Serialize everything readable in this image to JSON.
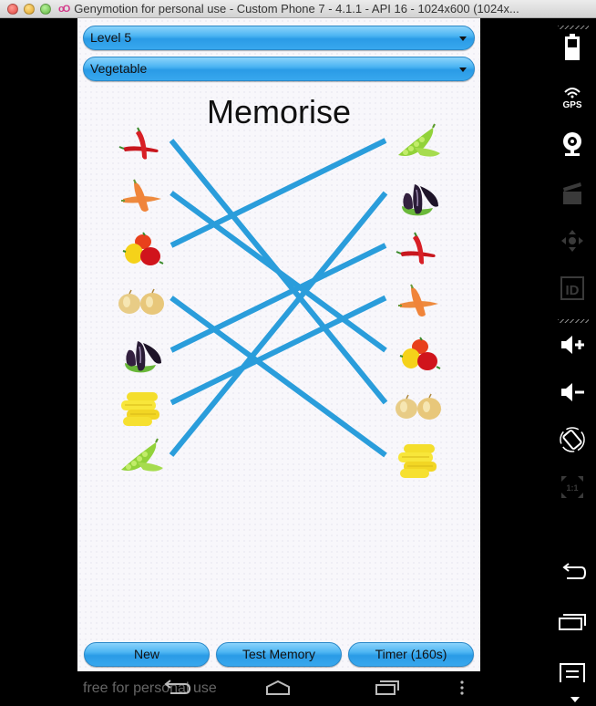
{
  "window": {
    "title": "Genymotion for personal use - Custom Phone 7 - 4.1.1 - API 16 - 1024x600 (1024x..."
  },
  "app": {
    "level_spinner": {
      "selected": "Level 5"
    },
    "category_spinner": {
      "selected": "Vegetable"
    },
    "heading": "Memorise",
    "left_column": [
      "chili",
      "carrot",
      "bell-pepper",
      "onion",
      "eggplant",
      "corn",
      "peas"
    ],
    "right_column": [
      "peas",
      "eggplant",
      "chili",
      "carrot",
      "bell-pepper",
      "onion",
      "corn"
    ],
    "connections": [
      {
        "from": "chili",
        "to": "onion"
      },
      {
        "from": "carrot",
        "to": "bell-pepper"
      },
      {
        "from": "bell-pepper",
        "to": "peas"
      },
      {
        "from": "onion",
        "to": "corn"
      },
      {
        "from": "eggplant",
        "to": "chili"
      },
      {
        "from": "corn",
        "to": "carrot"
      },
      {
        "from": "peas",
        "to": "eggplant"
      }
    ],
    "line_color": "#2a9ddb",
    "buttons": {
      "new": "New",
      "test_memory": "Test Memory",
      "timer": "Timer (160s)"
    }
  },
  "android_nav": {
    "watermark": "free for personal use",
    "icons": [
      "back-icon",
      "home-icon",
      "recent-apps-icon",
      "overflow-menu-icon"
    ]
  },
  "genymotion_sidebar": {
    "icons": [
      "battery-icon",
      "gps-icon",
      "webcam-icon",
      "screencast-icon",
      "dpad-icon",
      "device-id-icon",
      "volume-up-icon",
      "volume-down-icon",
      "rotate-icon",
      "scale-icon",
      "back-icon",
      "recent-apps-icon",
      "menu-icon"
    ]
  }
}
